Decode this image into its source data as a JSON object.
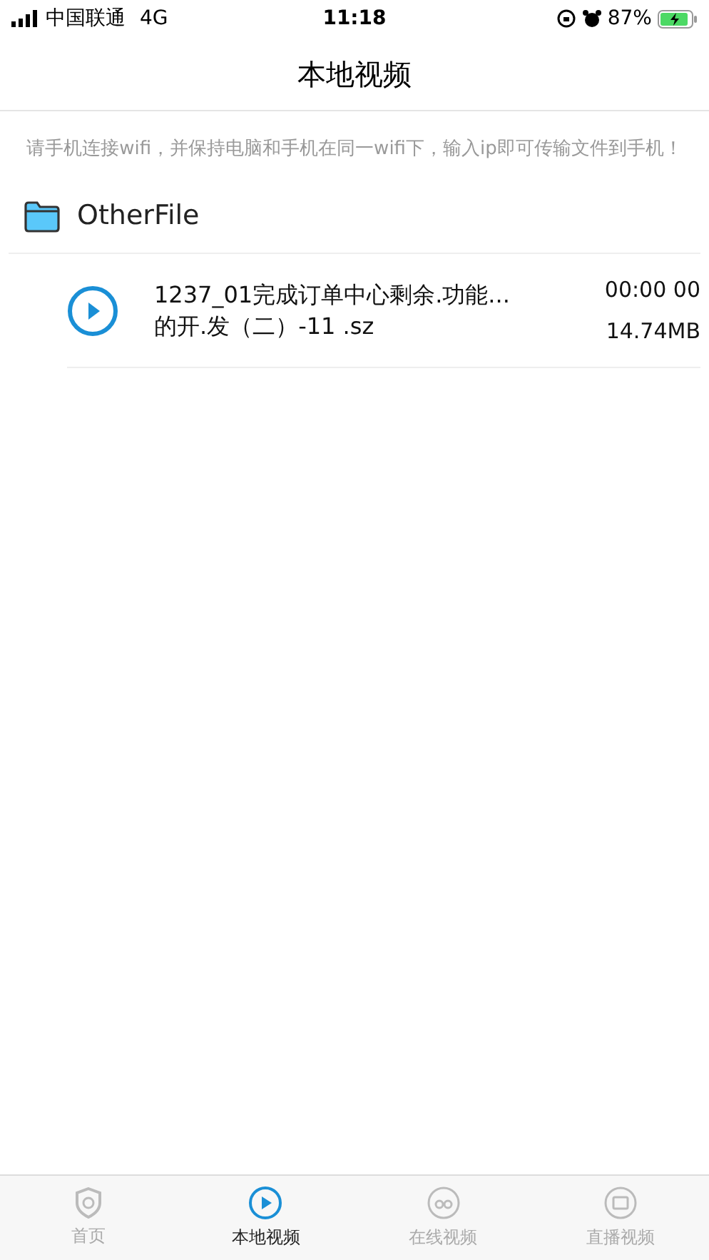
{
  "status_bar": {
    "carrier": "中国联通",
    "network": "4G",
    "time": "11:18",
    "battery": "87%"
  },
  "nav": {
    "title": "本地视频"
  },
  "notice": "请手机连接wifi，并保持电脑和手机在同一wifi下，输入ip即可传输文件到手机！",
  "folder": {
    "name": "OtherFile"
  },
  "files": [
    {
      "name": "1237_01完成订单中心剩余.功能...的开.发（二）-11 .sz",
      "duration": "00:00 00",
      "size": "14.74MB"
    }
  ],
  "tab_bar": [
    {
      "label": "首页",
      "kind": "home",
      "selected": false
    },
    {
      "label": "本地视频",
      "kind": "local",
      "selected": true
    },
    {
      "label": "在线视频",
      "kind": "online",
      "selected": false
    },
    {
      "label": "直播视频",
      "kind": "live",
      "selected": false
    }
  ]
}
